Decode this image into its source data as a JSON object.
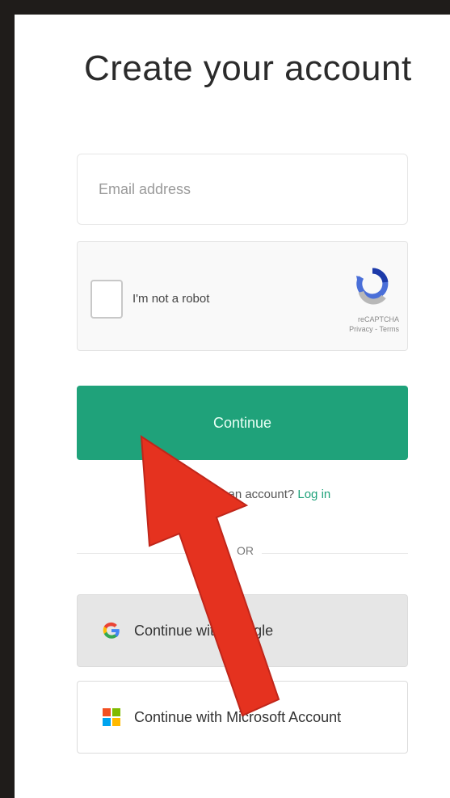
{
  "page": {
    "title": "Create your account"
  },
  "form": {
    "email_placeholder": "Email address",
    "email_value": "",
    "captcha_label": "I'm not a robot",
    "captcha_brand": "reCAPTCHA",
    "captcha_links": "Privacy - Terms",
    "continue_label": "Continue",
    "login_prompt": "Already have an account?",
    "login_link": "Log in",
    "divider_text": "OR"
  },
  "social": {
    "google_label": "Continue with Google",
    "microsoft_label": "Continue with Microsoft Account"
  },
  "colors": {
    "accent": "#1fa27a",
    "annotation_arrow": "#e5321f"
  }
}
